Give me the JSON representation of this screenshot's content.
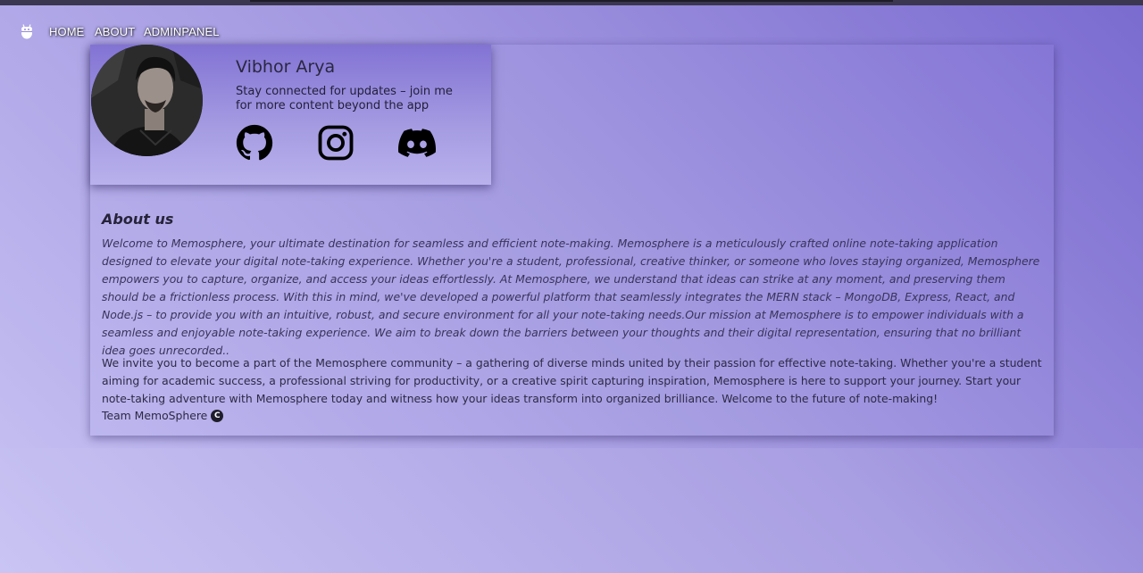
{
  "nav": {
    "brand_icon": "android-robot-icon",
    "links": [
      "HOME",
      "ABOUT",
      "ADMINPANEL"
    ]
  },
  "profile": {
    "name": "Vibhor Arya",
    "tagline": "Stay connected for updates – join me for more content beyond the app",
    "social": [
      "github-icon",
      "instagram-icon",
      "discord-icon"
    ]
  },
  "about": {
    "title": "About us",
    "paragraph1": "Welcome to Memosphere, your ultimate destination for seamless and efficient note-making. Memosphere is a meticulously crafted online note-taking application designed to elevate your digital note-taking experience. Whether you're a student, professional, creative thinker, or someone who loves staying organized, Memosphere empowers you to capture, organize, and access your ideas effortlessly. At Memosphere, we understand that ideas can strike at any moment, and preserving them should be a frictionless process. With this in mind, we've developed a powerful platform that seamlessly integrates the MERN stack – MongoDB, Express, React, and Node.js – to provide you with an intuitive, robust, and secure environment for all your note-taking needs.Our mission at Memosphere is to empower individuals with a seamless and enjoyable note-taking experience. We aim to break down the barriers between your thoughts and their digital representation, ensuring that no brilliant idea goes unrecorded..",
    "paragraph2": "We invite you to become a part of the Memosphere community – a gathering of diverse minds united by their passion for effective note-taking. Whether you're a student aiming for academic success, a professional striving for productivity, or a creative spirit capturing inspiration, Memosphere is here to support your journey. Start your note-taking adventure with Memosphere today and witness how your ideas transform into organized brilliance. Welcome to the future of note-making!",
    "signoff": "Team MemoSphere",
    "copyright_symbol": "C"
  },
  "colors": {
    "accent": "#7b6ccf",
    "text": "#2d2a45"
  }
}
